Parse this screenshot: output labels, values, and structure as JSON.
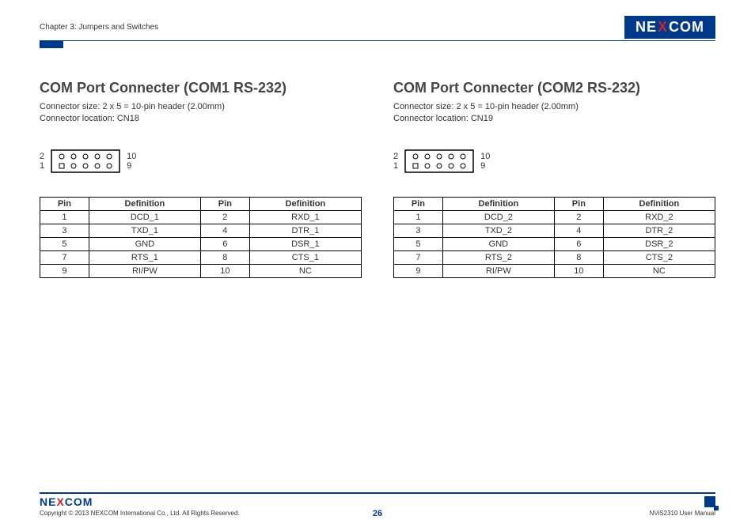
{
  "header": {
    "chapter": "Chapter 3: Jumpers and Switches",
    "logo_pre": "NE",
    "logo_x": "X",
    "logo_post": "COM"
  },
  "left": {
    "title": "COM Port Connecter (COM1 RS-232)",
    "size_line": "Connector size: 2 x 5 = 10-pin header (2.00mm)",
    "loc_line": "Connector location: CN18",
    "label_tl": "2",
    "label_bl": "1",
    "label_tr": "10",
    "label_br": "9",
    "head_pin": "Pin",
    "head_def": "Definition",
    "rows": [
      {
        "p1": "1",
        "d1": "DCD_1",
        "p2": "2",
        "d2": "RXD_1"
      },
      {
        "p1": "3",
        "d1": "TXD_1",
        "p2": "4",
        "d2": "DTR_1"
      },
      {
        "p1": "5",
        "d1": "GND",
        "p2": "6",
        "d2": "DSR_1"
      },
      {
        "p1": "7",
        "d1": "RTS_1",
        "p2": "8",
        "d2": "CTS_1"
      },
      {
        "p1": "9",
        "d1": "RI/PW",
        "p2": "10",
        "d2": "NC"
      }
    ]
  },
  "right": {
    "title": "COM Port Connecter (COM2 RS-232)",
    "size_line": "Connector size: 2 x 5 = 10-pin header (2.00mm)",
    "loc_line": "Connector location: CN19",
    "label_tl": "2",
    "label_bl": "1",
    "label_tr": "10",
    "label_br": "9",
    "head_pin": "Pin",
    "head_def": "Definition",
    "rows": [
      {
        "p1": "1",
        "d1": "DCD_2",
        "p2": "2",
        "d2": "RXD_2"
      },
      {
        "p1": "3",
        "d1": "TXD_2",
        "p2": "4",
        "d2": "DTR_2"
      },
      {
        "p1": "5",
        "d1": "GND",
        "p2": "6",
        "d2": "DSR_2"
      },
      {
        "p1": "7",
        "d1": "RTS_2",
        "p2": "8",
        "d2": "CTS_2"
      },
      {
        "p1": "9",
        "d1": "RI/PW",
        "p2": "10",
        "d2": "NC"
      }
    ]
  },
  "footer": {
    "copyright": "Copyright © 2013 NEXCOM International Co., Ltd. All Rights Reserved.",
    "page": "26",
    "manual": "NViS2310 User Manual"
  }
}
